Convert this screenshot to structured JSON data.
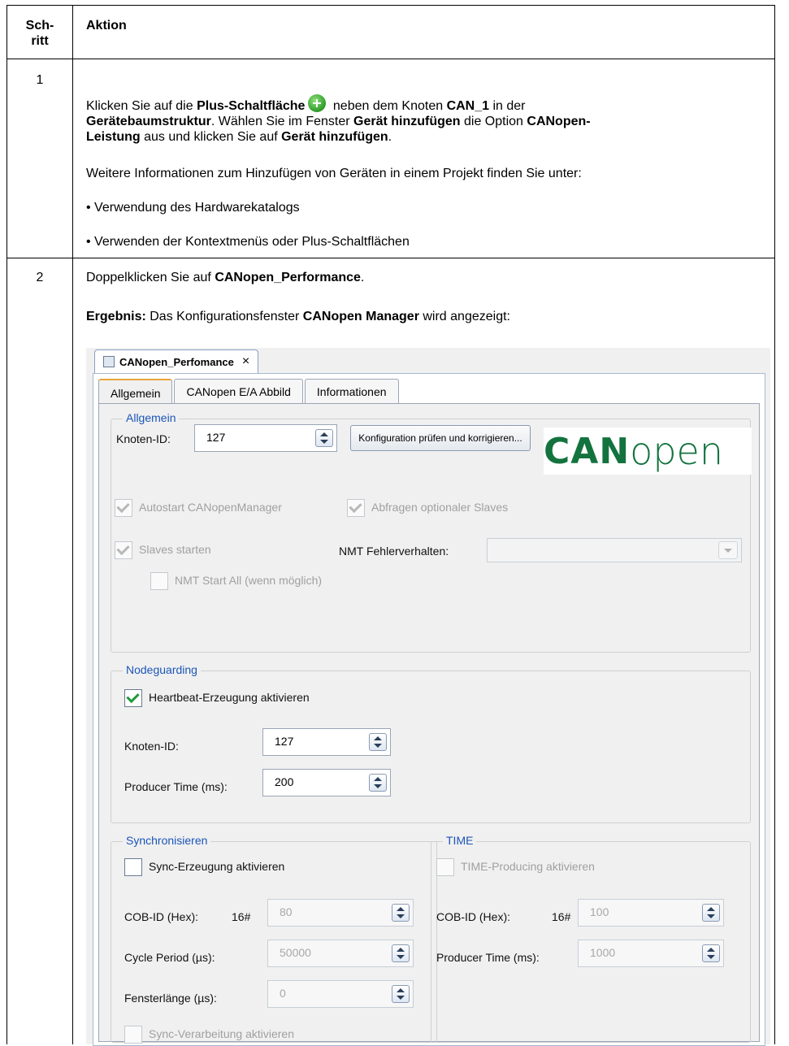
{
  "table": {
    "header_step": "Sch-\nritt",
    "header_action": "Aktion"
  },
  "step1": {
    "number": "1",
    "p1_a": "Klicken Sie auf die ",
    "p1_b": "Plus-Schaltfläche",
    "p1_c": " neben dem Knoten ",
    "p1_d": "CAN_1",
    "p1_e": " in der",
    "p1_f": "Gerätebaumstruktur",
    "p1_g": ". Wählen Sie im Fenster ",
    "p1_h": "Gerät hinzufügen",
    "p1_i": " die Option ",
    "p1_j": "CANopen-",
    "p1_k": "Leistung",
    "p1_l": " aus und klicken Sie auf ",
    "p1_m": "Gerät hinzufügen",
    "p1_n": ".",
    "p2": "Weitere Informationen zum Hinzufügen von Geräten in einem Projekt finden Sie unter:",
    "bullet1": "• Verwendung des Hardwarekatalogs",
    "bullet2": "• Verwenden der Kontextmenüs oder Plus-Schaltflächen"
  },
  "step2": {
    "number": "2",
    "p1_a": "Doppelklicken Sie auf ",
    "p1_b": "CANopen_Performance",
    "p1_c": ".",
    "p2_a": "Ergebnis:",
    "p2_b": " Das Konfigurationsfenster ",
    "p2_c": "CANopen Manager",
    "p2_d": " wird angezeigt:"
  },
  "screenshot": {
    "doc_tab": "CANopen_Perfomance",
    "close_glyph": "×",
    "tabs": [
      "Allgemein",
      "CANopen E/A Abbild",
      "Informationen"
    ],
    "general": {
      "title": "Allgemein",
      "node_id_label": "Knoten-ID:",
      "node_id_value": "127",
      "check_button": "Konfiguration prüfen und korrigieren...",
      "logo_can": "CAN",
      "logo_open": "open",
      "autostart": "Autostart CANopenManager",
      "optional_slaves": "Abfragen optionaler Slaves",
      "start_slaves": "Slaves starten",
      "nmt_error_label": "NMT Fehlerverhalten:",
      "nmt_start_all": "NMT Start All (wenn möglich)"
    },
    "nodeguarding": {
      "title": "Nodeguarding",
      "heartbeat": "Heartbeat-Erzeugung aktivieren",
      "node_id_label": "Knoten-ID:",
      "node_id_value": "127",
      "producer_label": "Producer Time (ms):",
      "producer_value": "200"
    },
    "sync": {
      "title": "Synchronisieren",
      "enable": "Sync-Erzeugung aktivieren",
      "cob_label": "COB-ID (Hex):",
      "cob_prefix": "16#",
      "cob_value": "80",
      "cycle_label": "Cycle Period (µs):",
      "cycle_value": "50000",
      "window_label": "Fensterlänge (µs):",
      "window_value": "0",
      "processing": "Sync-Verarbeitung aktivieren"
    },
    "time": {
      "title": "TIME",
      "enable": "TIME-Producing aktivieren",
      "cob_label": "COB-ID (Hex):",
      "cob_prefix": "16#",
      "cob_value": "100",
      "producer_label": "Producer Time (ms):",
      "producer_value": "1000"
    }
  }
}
